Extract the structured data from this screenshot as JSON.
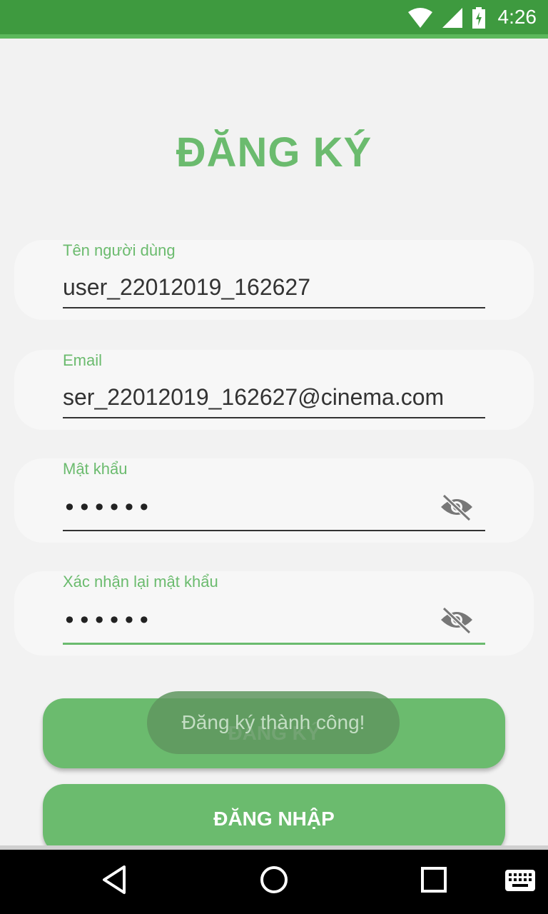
{
  "status_bar": {
    "time": "4:26"
  },
  "page_title": "ĐĂNG KÝ",
  "fields": {
    "username": {
      "label": "Tên người dùng",
      "value": "user_22012019_162627"
    },
    "email": {
      "label": "Email",
      "value": "ser_22012019_162627@cinema.com"
    },
    "password": {
      "label": "Mật khẩu",
      "value": "••••••"
    },
    "confirm_password": {
      "label": "Xác nhận lại mật khẩu",
      "value": "••••••"
    }
  },
  "buttons": {
    "register": "ĐĂNG KÝ",
    "login": "ĐĂNG NHẬP"
  },
  "toast": "Đăng ký thành công!",
  "colors": {
    "accent": "#6bbb6e",
    "status_bar": "#3e9a3f"
  }
}
